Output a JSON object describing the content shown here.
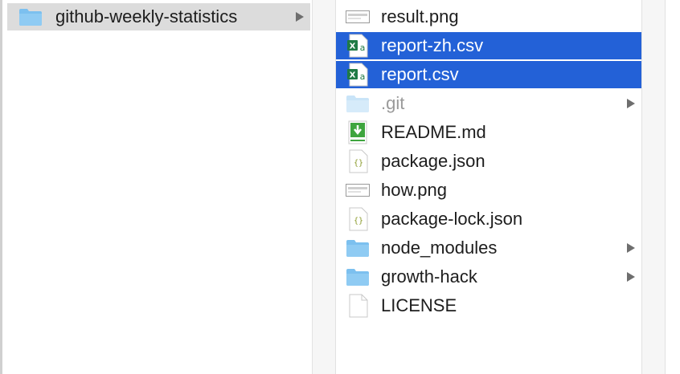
{
  "columns": {
    "parent": {
      "items": [
        {
          "name": "github-weekly-statistics",
          "icon": "folder-icon",
          "has_children": true
        }
      ]
    },
    "current": {
      "items": [
        {
          "name": "result.png",
          "icon": "image-file-icon",
          "selected": false,
          "has_children": false
        },
        {
          "name": "report-zh.csv",
          "icon": "excel-csv-icon",
          "selected": true,
          "has_children": false
        },
        {
          "name": "report.csv",
          "icon": "excel-csv-icon",
          "selected": true,
          "has_children": false
        },
        {
          "name": ".git",
          "icon": "folder-icon",
          "selected": false,
          "has_children": true,
          "dimmed": true
        },
        {
          "name": "README.md",
          "icon": "markdown-download-icon",
          "selected": false,
          "has_children": false
        },
        {
          "name": "package.json",
          "icon": "json-file-icon",
          "selected": false,
          "has_children": false
        },
        {
          "name": "how.png",
          "icon": "image-file-icon",
          "selected": false,
          "has_children": false
        },
        {
          "name": "package-lock.json",
          "icon": "json-file-icon",
          "selected": false,
          "has_children": false
        },
        {
          "name": "node_modules",
          "icon": "folder-icon",
          "selected": false,
          "has_children": true
        },
        {
          "name": "growth-hack",
          "icon": "folder-icon",
          "selected": false,
          "has_children": true
        },
        {
          "name": "LICENSE",
          "icon": "blank-file-icon",
          "selected": false,
          "has_children": false
        }
      ]
    }
  },
  "colors": {
    "selection": "#2361d7",
    "parent_selection": "#dcdcdc",
    "folder": "#7cc0ef"
  }
}
